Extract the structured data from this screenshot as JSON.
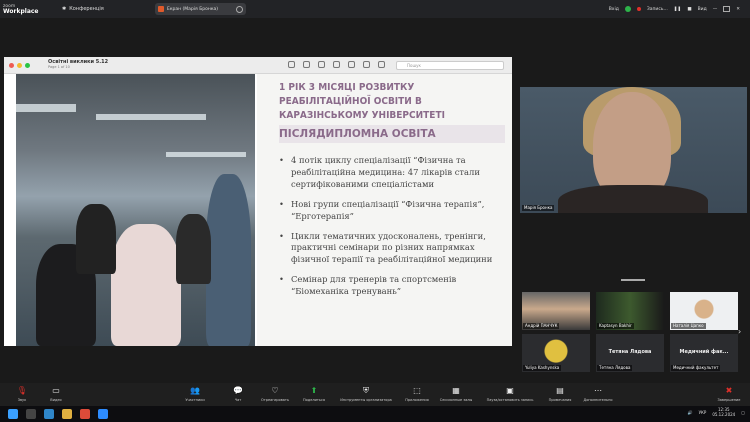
{
  "topbar": {
    "logo_top": "zoom",
    "logo_bottom": "Workplace",
    "conference_label": "Конференція",
    "share_pill": "Екран (Марія Бронка)",
    "login": "Вхід",
    "recording": "Запись...",
    "view": "Вид"
  },
  "keynote": {
    "title": "Освітні виклики 5.12",
    "subtitle": "Page 1 of 10",
    "search_placeholder": "Пошук"
  },
  "slide": {
    "title": "1 РІК 3 МІСЯЦІ РОЗВИТКУ РЕАБІЛІТАЦІЙНОЇ ОСВІТИ В КАРАЗІНСЬКОМУ УНІВЕРСИТЕТІ",
    "subtitle": "ПІСЛЯДИПЛОМНА ОСВІТА",
    "bullets": [
      "4 потік циклу спеціалізації “Фізична та реабілітаційна медицина: 47 лікарів стали сертифікованими спеціалістами",
      "Нові групи спеціалізації “Фізична терапія”, “Ерготерапія”",
      "Цикли тематичних удосконалень, тренінги, практичні семінари по різних напрямках фізичної терапії та реабілітаційної медицини",
      "Семінар для тренерів та спортсменів “Біомеханіка тренувань”"
    ]
  },
  "selfview": {
    "name": "Марія Бронка"
  },
  "participants": [
    {
      "name": "Андрій ПАНЧУК"
    },
    {
      "name": "Kaptasyn Bakhir"
    },
    {
      "name": "Наталія Цапко"
    },
    {
      "name": "Yuliya Kashynska"
    },
    {
      "name": "Тетяна Лядова",
      "label": "Тетяна Лядова"
    },
    {
      "name": "Медичний факультет",
      "label": "Медичний фак..."
    }
  ],
  "toolbar": {
    "items": [
      {
        "label": "Звук"
      },
      {
        "label": "Видео"
      },
      {
        "label": "Участники",
        "count": "20"
      },
      {
        "label": "Чат"
      },
      {
        "label": "Отреагировать"
      },
      {
        "label": "Поделиться"
      },
      {
        "label": "Инструменты организатора"
      },
      {
        "label": "Приложения"
      },
      {
        "label": "Сессионные залы"
      },
      {
        "label": "Пауза/остановить запись"
      },
      {
        "label": "Примечания"
      },
      {
        "label": "Дополнительно"
      },
      {
        "label": "Завершение"
      }
    ]
  },
  "taskbar": {
    "lang": "УКР",
    "time": "12:35",
    "date": "05.12.2024"
  }
}
